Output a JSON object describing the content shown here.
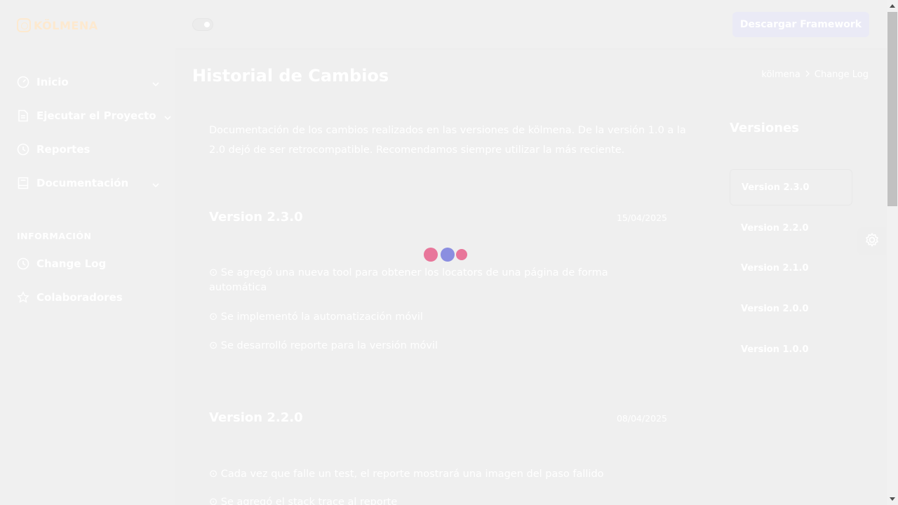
{
  "app": {
    "logo_text": "KÖLMENA"
  },
  "sidebar": {
    "items": [
      {
        "label": "Inicio",
        "icon": "gauge-icon"
      },
      {
        "label": "Ejecutar el Proyecto",
        "icon": "document-icon"
      },
      {
        "label": "Reportes",
        "icon": "clock-icon"
      },
      {
        "label": "Documentación",
        "icon": "book-icon"
      }
    ],
    "section_title": "INFORMACIÓN",
    "info_items": [
      {
        "label": "Change Log",
        "icon": "clock-icon"
      },
      {
        "label": "Colaboradores",
        "icon": "star-icon"
      }
    ]
  },
  "topbar": {
    "download_label": "Descargar Framework"
  },
  "page": {
    "title": "Historial de Cambios",
    "breadcrumb": [
      "kölmena",
      "Change Log"
    ],
    "intro": "Documentación de los cambios realizados en las versiones de kölmena. De la versión 1.0 a la 2.0 dejó de ser retrocompatible. Recomendamos siempre utilizar la más reciente."
  },
  "versions": [
    {
      "title": "Version 2.3.0",
      "date": "15/04/2025",
      "changes": [
        "Se agregó una nueva tool para obtener los locators de una página de forma automática",
        "Se implementó la automatización móvil",
        "Se desarrolló reporte para la versión móvil"
      ]
    },
    {
      "title": "Version 2.2.0",
      "date": "08/04/2025",
      "changes": [
        "Cada vez que falle un test, el reporte mostrará una imagen del paso fallido",
        "Se agregó el stack trace al reporte"
      ]
    }
  ],
  "version_nav": {
    "title": "Versiones",
    "items": [
      "Version 2.3.0",
      "Version 2.2.0",
      "Version 2.1.0",
      "Version 2.0.0",
      "Version 1.0.0"
    ],
    "active_index": 0
  },
  "colors": {
    "loader_pink": "#e8769a",
    "loader_blue": "#8b8ee0",
    "logo": "#fde9cf"
  }
}
